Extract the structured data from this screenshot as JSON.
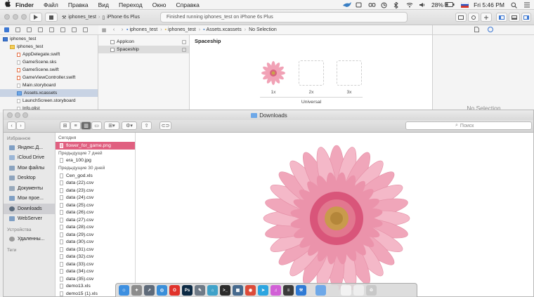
{
  "menubar": {
    "apple": "",
    "app_name": "Finder",
    "items": [
      "Файл",
      "Правка",
      "Вид",
      "Переход",
      "Окно",
      "Справка"
    ],
    "battery": "28%",
    "clock": "Fri 5:46 PM"
  },
  "xcode": {
    "scheme": {
      "project": "iphones_test",
      "device": "iPhone 6s Plus"
    },
    "activity": "Finished running iphones_test on iPhone 6s Plus",
    "jump_bar": [
      "iphones_test",
      "iphones_test",
      "Assets.xcassets",
      "No Selection"
    ],
    "navigator": [
      {
        "label": "iphones_test",
        "kind": "project",
        "indent": 0
      },
      {
        "label": "iphones_test",
        "kind": "folder",
        "indent": 1
      },
      {
        "label": "AppDelegate.swift",
        "kind": "swift",
        "indent": 2
      },
      {
        "label": "GameScene.sks",
        "kind": "file",
        "indent": 2
      },
      {
        "label": "GameScene.swift",
        "kind": "swift",
        "indent": 2
      },
      {
        "label": "GameViewController.swift",
        "kind": "swift",
        "indent": 2
      },
      {
        "label": "Main.storyboard",
        "kind": "file",
        "indent": 2
      },
      {
        "label": "Assets.xcassets",
        "kind": "assets",
        "indent": 2,
        "selected": true
      },
      {
        "label": "LaunchScreen.storyboard",
        "kind": "file",
        "indent": 2
      },
      {
        "label": "Info.plist",
        "kind": "file",
        "indent": 2
      }
    ],
    "assets": [
      {
        "label": "AppIcon",
        "selected": false
      },
      {
        "label": "Spaceship",
        "selected": true
      }
    ],
    "editor": {
      "title": "Spaceship",
      "slots": [
        "1x",
        "2x",
        "3x"
      ],
      "universal": "Universal"
    },
    "inspector": {
      "empty": "No Selection"
    }
  },
  "finder": {
    "title": "Downloads",
    "search_placeholder": "Поиск",
    "sidebar": {
      "favorites_header": "Избранное",
      "favorites": [
        {
          "label": "Яндекс.Д...",
          "icon": "folder-icon"
        },
        {
          "label": "iCloud Drive",
          "icon": "cloud-icon"
        },
        {
          "label": "Мои файлы",
          "icon": "files-icon"
        },
        {
          "label": "Desktop",
          "icon": "desktop-icon"
        },
        {
          "label": "Документы",
          "icon": "documents-icon"
        },
        {
          "label": "Мои прое...",
          "icon": "folder-icon"
        },
        {
          "label": "Downloads",
          "icon": "downloads-icon",
          "selected": true
        },
        {
          "label": "WebServer",
          "icon": "folder-icon"
        }
      ],
      "devices_header": "Устройства",
      "devices": [
        {
          "label": "Удаленны...",
          "icon": "disc-icon"
        }
      ],
      "tags_header": "Теги"
    },
    "list": {
      "today_header": "Сегодня",
      "today": [
        {
          "label": "flower_for_game.png",
          "selected": true
        }
      ],
      "week_header": "Предыдущие 7 дней",
      "week": [
        {
          "label": "era_100.jpg"
        }
      ],
      "month_header": "Предыдущие 30 дней",
      "month": [
        {
          "label": "Cen_god.xls"
        },
        {
          "label": "data (22).csv"
        },
        {
          "label": "data (23).csv"
        },
        {
          "label": "data (24).csv"
        },
        {
          "label": "data (25).csv"
        },
        {
          "label": "data (26).csv"
        },
        {
          "label": "data (27).csv"
        },
        {
          "label": "data (28).csv"
        },
        {
          "label": "data (29).csv"
        },
        {
          "label": "data (30).csv"
        },
        {
          "label": "data (31).csv"
        },
        {
          "label": "data (32).csv"
        },
        {
          "label": "data (33).csv"
        },
        {
          "label": "data (34).csv"
        },
        {
          "label": "data (35).csv"
        },
        {
          "label": "demo13.xls"
        },
        {
          "label": "demo15 (1).xls"
        }
      ]
    }
  },
  "dock": {
    "apps": [
      {
        "name": "finder-icon",
        "color": "#3d8fe0",
        "glyph": "☺"
      },
      {
        "name": "launchpad-icon",
        "color": "#8c8c8c",
        "glyph": "✦"
      },
      {
        "name": "rocket-icon",
        "color": "#5f6b7a",
        "glyph": "➚"
      },
      {
        "name": "safari-icon",
        "color": "#3a8fd9",
        "glyph": "◎"
      },
      {
        "name": "opera-icon",
        "color": "#e0322b",
        "glyph": "O"
      },
      {
        "name": "photoshop-icon",
        "color": "#0c2a44",
        "glyph": "Ps"
      },
      {
        "name": "tools-icon",
        "color": "#6e7a87",
        "glyph": "✎"
      },
      {
        "name": "utilities-icon",
        "color": "#3fa2c9",
        "glyph": "⌂"
      },
      {
        "name": "terminal-icon",
        "color": "#2b2b2b",
        "glyph": ">_"
      },
      {
        "name": "remote-icon",
        "color": "#466a8e",
        "glyph": "▦"
      },
      {
        "name": "chrome-icon",
        "color": "#dd4b39",
        "glyph": "◉"
      },
      {
        "name": "telegram-icon",
        "color": "#2ca5e0",
        "glyph": "➤"
      },
      {
        "name": "itunes-icon",
        "color": "#d15fd6",
        "glyph": "♫"
      },
      {
        "name": "console-icon",
        "color": "#3b3b3b",
        "glyph": "≡"
      },
      {
        "name": "xcode-icon",
        "color": "#2f7ad5",
        "glyph": "⚒"
      },
      {
        "name": "folder-icon",
        "color": "#6ea8e8",
        "glyph": ""
      },
      {
        "name": "preview-icon",
        "color": "#dcdcdc",
        "glyph": ""
      },
      {
        "name": "document-icon",
        "color": "#f2f2f2",
        "glyph": ""
      },
      {
        "name": "document-icon",
        "color": "#eeeeee",
        "glyph": ""
      },
      {
        "name": "trash-icon",
        "color": "#c8c8c8",
        "glyph": "♲"
      }
    ]
  }
}
